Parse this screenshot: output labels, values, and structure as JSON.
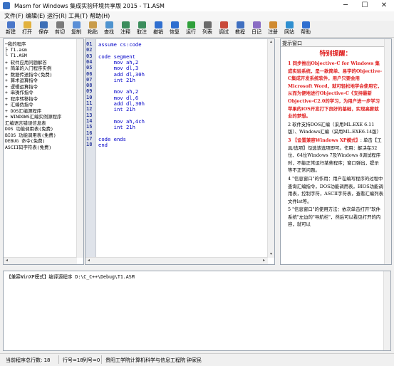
{
  "window": {
    "title": "Masm for Windows 集成实验环境共享版 2015 - T1.ASM",
    "minimize": "─",
    "maximize": "☐",
    "close": "✕"
  },
  "menu": [
    "文件(F)",
    "编辑(E)",
    "运行(R)",
    "工具(T)",
    "帮助(H)"
  ],
  "toolbar": [
    {
      "label": "新建",
      "icon": "new-file-icon",
      "color": "#4a77c9"
    },
    {
      "label": "打开",
      "icon": "open-folder-icon",
      "color": "#e2b13c"
    },
    {
      "label": "保存",
      "icon": "save-icon",
      "color": "#3d6fb6"
    },
    {
      "label": "剪切",
      "icon": "cut-icon",
      "color": "#7a7a7a"
    },
    {
      "label": "复制",
      "icon": "copy-icon",
      "color": "#5b8fd6"
    },
    {
      "label": "粘贴",
      "icon": "paste-icon",
      "color": "#c99c4a"
    },
    {
      "label": "查找",
      "icon": "find-icon",
      "color": "#4e93cf"
    },
    {
      "label": "注释",
      "icon": "comment-icon",
      "color": "#3b8d5c"
    },
    {
      "label": "取注",
      "icon": "uncomment-icon",
      "color": "#3b8d5c"
    },
    {
      "label": "撤销",
      "icon": "undo-icon",
      "color": "#2f6fd0"
    },
    {
      "label": "恢复",
      "icon": "redo-icon",
      "color": "#2f6fd0"
    },
    {
      "label": "运行",
      "icon": "run-icon",
      "color": "#2e9f3a"
    },
    {
      "label": "列表",
      "icon": "list-icon",
      "color": "#6b6b6b"
    },
    {
      "label": "调试",
      "icon": "debug-icon",
      "color": "#c94a3a"
    },
    {
      "label": "教程",
      "icon": "tutorial-icon",
      "color": "#3f6fc0"
    },
    {
      "label": "日记",
      "icon": "diary-icon",
      "color": "#8a6cc4"
    },
    {
      "label": "注册",
      "icon": "register-icon",
      "color": "#d08a2f"
    },
    {
      "label": "网站",
      "icon": "website-icon",
      "color": "#2f8fd0"
    },
    {
      "label": "帮助",
      "icon": "help-icon",
      "color": "#2f6fd0"
    }
  ],
  "tree": [
    "─我的程序",
    "  ├ T1.asm",
    "  └ T1.ASM",
    "+ 软件应用问题解答",
    "+ 简单的入门程序实例",
    "+ 数据传送指令(免费)",
    "+ 算术运算指令",
    "+ 逻辑运算指令",
    "+ 串操作指令",
    "+ 程序转移指令",
    "+ 汇编伪指令",
    "+ DOS汇编源程序",
    "+ WINDOWS汇编实例源程序",
    "  汇编语言错误信息表",
    "  DOS 功能调用表(免费)",
    "  BIOS 功能调用表(免费)",
    "  DEBUG 命令(免费)",
    "  ASCII码字符表(免费)"
  ],
  "editor": {
    "line_numbers": [
      "01",
      "02",
      "03",
      "04",
      "05",
      "06",
      "07",
      "08",
      "09",
      "10",
      "11",
      "12",
      "13",
      "14",
      "15",
      "16",
      "17",
      "18"
    ],
    "code": [
      "assume cs:code",
      "",
      "code segment",
      "     mov ah,2",
      "     mov dl,3",
      "     add dl,30h",
      "     int 21h",
      "",
      "     mov ah,2",
      "     mov dl,6",
      "     add dl,30h",
      "     int 21h",
      "",
      "     mov ah,4ch",
      "     int 21h",
      "",
      "code ends",
      "end"
    ]
  },
  "helper": {
    "header": "提示窗口",
    "warn_title": "特别提醒：",
    "p1_red": "1 同步推出Objective-C for Windows 集成实验系统，是一款简单、易学的Objective-C集成开发系统软件，用户只要会用Microsoft Word，就可轻松地学会使用它，从而为便地进行Objective-C《支持最新Objective-C2.0的学习，为用户进一步学习苹果的iOS开发打下良好的基础，实现高薪就业的梦想。",
    "p2": "2 软件支持DOS汇编（采用ML.EXE 6.11版）、Windows汇编（采用ML.EXE6.14版）",
    "p3_red": "3 【设置兼容Windows XP模式】",
    "p3_rest": ": 单击【工具/选项】勾选该选项即可。作用：解决在32位、64位Windows 7及Windows 8调试程序时，不能正常运行某些程序；窗口弹出，提示等不正常问题。",
    "p4": "4 \"信息窗口\"的作用：用户在编写程序的过程中查询汇编指令，DOS功能调用表，BIOS功能调用表，控制字符，ASCII字符表，查看汇编列表文件lst等。",
    "p5": "5 \"信息窗口\"的使用方法：依次单击打开\"软件系统\"左边的\"导航栏\"，然后可以看见打开的内容，就可以"
  },
  "output": {
    "text": "【兼容WinXP模式】编译源程序 D:\\C_C++\\Debug\\T1.ASM"
  },
  "status": {
    "total_lines": "当前程序总行数: 18",
    "row": "行号=18",
    "col": "列号=0",
    "org": "贵阳工学院计算机科学与信息工程院",
    "author": "钟家民"
  }
}
